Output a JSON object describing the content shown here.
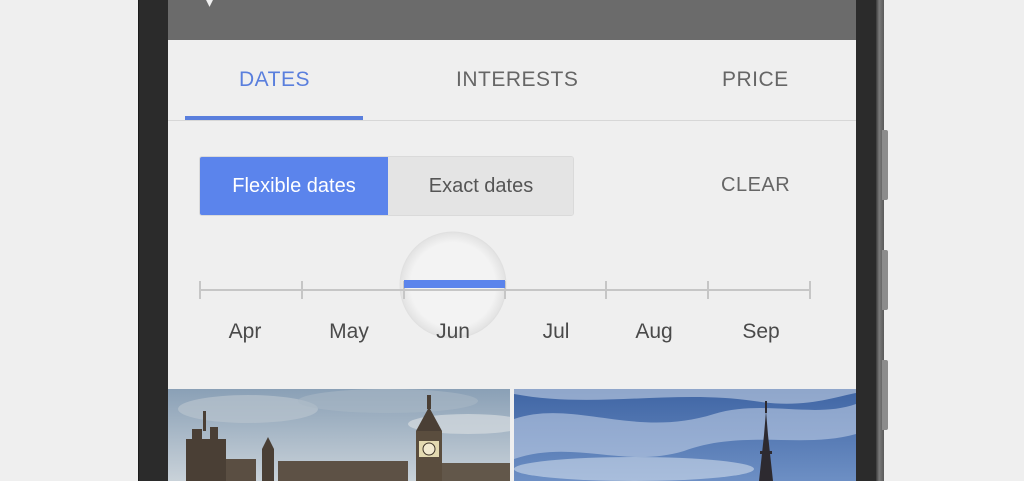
{
  "tabs": [
    {
      "label": "DATES",
      "active": true
    },
    {
      "label": "INTERESTS",
      "active": false
    },
    {
      "label": "PRICE",
      "active": false
    }
  ],
  "date_mode": {
    "flexible_label": "Flexible dates",
    "exact_label": "Exact dates",
    "selected": "Flexible dates",
    "clear_label": "CLEAR"
  },
  "months": {
    "labels": [
      "Apr",
      "May",
      "Jun",
      "Jul",
      "Aug",
      "Sep"
    ],
    "selected": "Jun"
  },
  "photos": [
    {
      "name": "london-photo"
    },
    {
      "name": "paris-photo"
    }
  ],
  "colors": {
    "accent": "#5a7fdd",
    "toggle_active": "#5b84ec",
    "toggle_inactive": "#e4e4e4",
    "appbar": "#6b6b6b",
    "screen_bg": "#efefef",
    "text": "#666666"
  }
}
